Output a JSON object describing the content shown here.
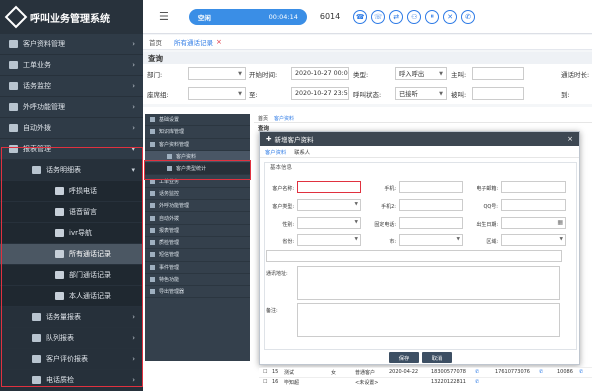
{
  "app": {
    "title": "呼叫业务管理系统"
  },
  "sidebar": {
    "items": [
      {
        "label": "客户资料管理",
        "level": 0,
        "arrow": "›",
        "active": false
      },
      {
        "label": "工单业务",
        "level": 0,
        "arrow": "›",
        "active": false
      },
      {
        "label": "话务监控",
        "level": 0,
        "arrow": "›",
        "active": false
      },
      {
        "label": "外呼功能管理",
        "level": 0,
        "arrow": "›",
        "active": false
      },
      {
        "label": "自动外拨",
        "level": 0,
        "arrow": "›",
        "active": false
      },
      {
        "label": "报表管理",
        "level": 0,
        "arrow": "▾",
        "active": false
      },
      {
        "label": "话务明细表",
        "level": 1,
        "arrow": "▾",
        "active": false
      },
      {
        "label": "呼损电话",
        "level": 2,
        "arrow": "",
        "active": false
      },
      {
        "label": "语音留言",
        "level": 2,
        "arrow": "",
        "active": false
      },
      {
        "label": "ivr导航",
        "level": 2,
        "arrow": "",
        "active": false
      },
      {
        "label": "所有通话记录",
        "level": 2,
        "arrow": "",
        "active": true
      },
      {
        "label": "部门通话记录",
        "level": 2,
        "arrow": "",
        "active": false
      },
      {
        "label": "本人通话记录",
        "level": 2,
        "arrow": "",
        "active": false
      },
      {
        "label": "话务量报表",
        "level": 1,
        "arrow": "›",
        "active": false
      },
      {
        "label": "队列报表",
        "level": 1,
        "arrow": "›",
        "active": false
      },
      {
        "label": "客户评价报表",
        "level": 1,
        "arrow": "›",
        "active": false
      },
      {
        "label": "电话质检",
        "level": 1,
        "arrow": "›",
        "active": false
      }
    ]
  },
  "topbar": {
    "status": "空闲",
    "timer": "00:04:14",
    "agent_id": "6014",
    "phone_icons": [
      "phone-icon",
      "call-in-icon",
      "transfer-icon",
      "conference-icon",
      "hold-icon",
      "mute-icon",
      "hangup-icon"
    ]
  },
  "tabs": {
    "home": "首页",
    "current": "所有通话记录",
    "close": "×"
  },
  "query": {
    "title": "查询",
    "department": "部门:",
    "start_time_label": "开始时间:",
    "start_time": "2020-10-27 00:0",
    "type_label": "类型:",
    "type_value": "呼入呼出",
    "caller_label": "主叫:",
    "duration_label": "通话时长:",
    "seat_group": "座席组:",
    "to_label": "至:",
    "end_time": "2020-10-27 23:5",
    "call_status_label": "呼叫状态:",
    "call_status_value": "已接听",
    "callee_label": "被叫:",
    "to2_label": "到:"
  },
  "inner": {
    "items": [
      {
        "label": "基础设置",
        "sub": false,
        "hl": false
      },
      {
        "label": "知识库管理",
        "sub": false,
        "hl": false
      },
      {
        "label": "客户资料管理",
        "sub": false,
        "hl": false
      },
      {
        "label": "客户资料",
        "sub": true,
        "hl": true
      },
      {
        "label": "客户类型统计",
        "sub": true,
        "hl": false
      },
      {
        "label": "工单业务",
        "sub": false,
        "hl": false
      },
      {
        "label": "话务监控",
        "sub": false,
        "hl": false
      },
      {
        "label": "外呼功能管理",
        "sub": false,
        "hl": false
      },
      {
        "label": "自动外拨",
        "sub": false,
        "hl": false
      },
      {
        "label": "报表管理",
        "sub": false,
        "hl": false
      },
      {
        "label": "质检管理",
        "sub": false,
        "hl": false
      },
      {
        "label": "短信管理",
        "sub": false,
        "hl": false
      },
      {
        "label": "事件管理",
        "sub": false,
        "hl": false
      },
      {
        "label": "特色功能",
        "sub": false,
        "hl": false
      },
      {
        "label": "导出管理器",
        "sub": false,
        "hl": false
      }
    ],
    "tab_home": "首页",
    "tab_current": "客户资料",
    "behind_query": "查询"
  },
  "dialog": {
    "title": "新增客户资料",
    "close": "×",
    "tab1": "客户资料",
    "tab2": "联系人",
    "section": "基本信息",
    "name_label": "客户名称:",
    "phone_label": "手机:",
    "email_label": "电子邮箱:",
    "cust_type_label": "客户类型:",
    "phone2_label": "手机2:",
    "qq_label": "QQ号:",
    "gender_label": "性别:",
    "landline_label": "固定电话:",
    "birth_label": "出生日期:",
    "province_label": "省份:",
    "city_label": "市:",
    "district_label": "区域:",
    "address_label": "通讯地址:",
    "remark_label": "备注:",
    "save": "保存",
    "cancel": "取消"
  },
  "rows": [
    {
      "no": "15",
      "name": "测试",
      "gender": "女",
      "type": "普通客户",
      "date": "2020-04-22",
      "phone": "18300577078",
      "phone2": "17610773076",
      "tail": "10086"
    },
    {
      "no": "16",
      "name": "毕知超",
      "gender": "",
      "type": "<未设置>",
      "date": "",
      "phone": "13220122811",
      "phone2": "",
      "tail": ""
    }
  ]
}
